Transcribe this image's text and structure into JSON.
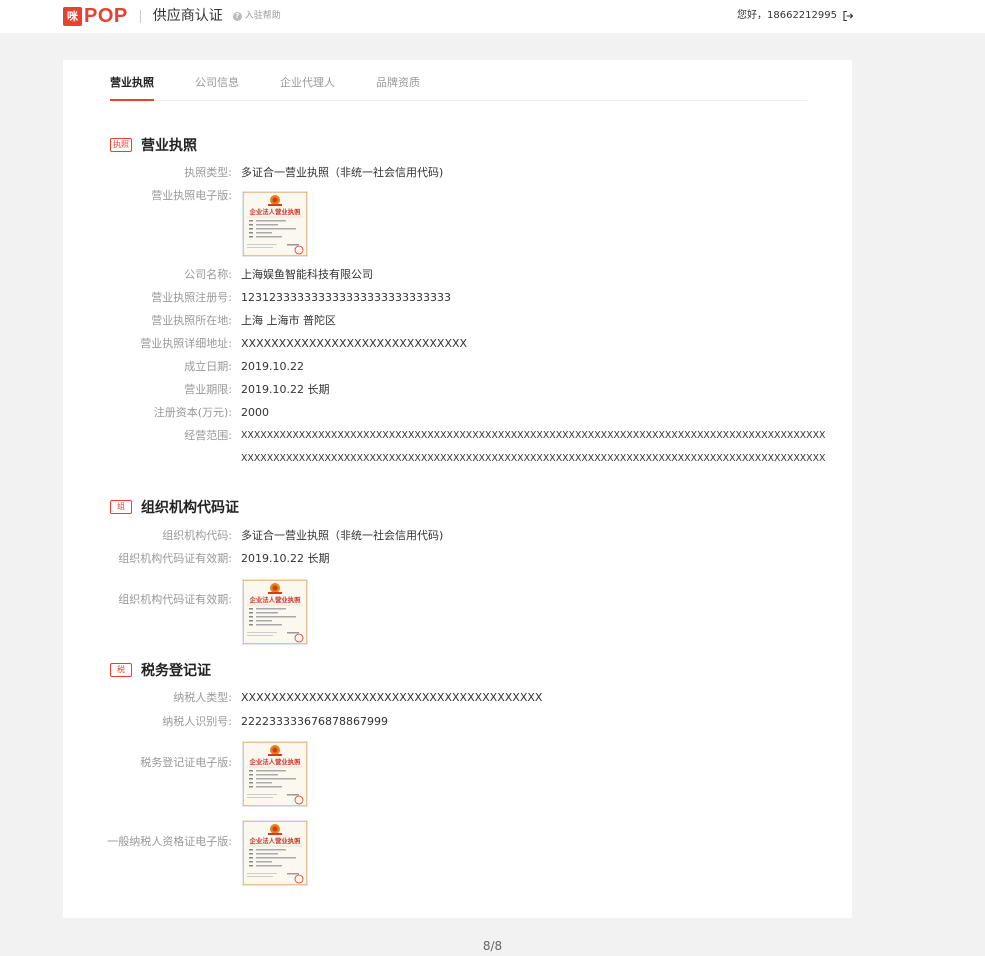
{
  "header": {
    "logo_mark": "咪",
    "logo_text": "POP",
    "title": "供应商认证",
    "help": "入驻帮助",
    "greeting": "您好，18662212995"
  },
  "tabs": [
    "营业执照",
    "公司信息",
    "企业代理人",
    "品牌资质"
  ],
  "license_section": {
    "icon": "执照",
    "title": "营业执照",
    "fields": [
      {
        "label": "执照类型:",
        "value": "多证合一营业执照（非统一社会信用代码)"
      },
      {
        "label": "营业执照电子版:",
        "value": ""
      },
      {
        "label": "公司名称:",
        "value": "上海娱鱼智能科技有限公司"
      },
      {
        "label": "营业执照注册号:",
        "value": "123123333333333333333333333333"
      },
      {
        "label": "营业执照所在地:",
        "value": "上海 上海市 普陀区"
      },
      {
        "label": "营业执照详细地址:",
        "value": "XXXXXXXXXXXXXXXXXXXXXXXXXXXXXX"
      },
      {
        "label": "成立日期:",
        "value": "2019.10.22"
      },
      {
        "label": "营业期限:",
        "value": "2019.10.22 长期"
      },
      {
        "label": "注册资本(万元):",
        "value": "2000"
      },
      {
        "label": "经营范围:",
        "value": "XXXXXXXXXXXXXXXXXXXXXXXXXXXXXXXXXXXXXXXXXXXXXXXXXXXXXXXXXXXXXXXXXXXXXXXXXXXXXXXXXXXXXXXXXXX"
      },
      {
        "label": "",
        "value": "XXXXXXXXXXXXXXXXXXXXXXXXXXXXXXXXXXXXXXXXXXXXXXXXXXXXXXXXXXXXXXXXXXXXXXXXXXXXXXXXXXXXXXXXXXX"
      }
    ]
  },
  "org_section": {
    "icon": "组",
    "title": "组织机构代码证",
    "fields": [
      {
        "label": "组织机构代码:",
        "value": "多证合一营业执照（非统一社会信用代码)"
      },
      {
        "label": "组织机构代码证有效期:",
        "value": "2019.10.22 长期"
      },
      {
        "label": "组织机构代码证有效期:",
        "value": ""
      }
    ]
  },
  "tax_section": {
    "icon": "税",
    "title": "税务登记证",
    "fields": [
      {
        "label": "纳税人类型:",
        "value": "XXXXXXXXXXXXXXXXXXXXXXXXXXXXXXXXXXXXXXXX"
      },
      {
        "label": "纳税人识别号:",
        "value": "222233333676878867999"
      },
      {
        "label": "税务登记证电子版:",
        "value": ""
      },
      {
        "label": "一般纳税人资格证电子版:",
        "value": ""
      }
    ]
  },
  "certificate_heading": "企业法人营业执照",
  "pager": "8/8",
  "colors": {
    "accent": "#e8412f",
    "background": "#f2f2f2"
  }
}
